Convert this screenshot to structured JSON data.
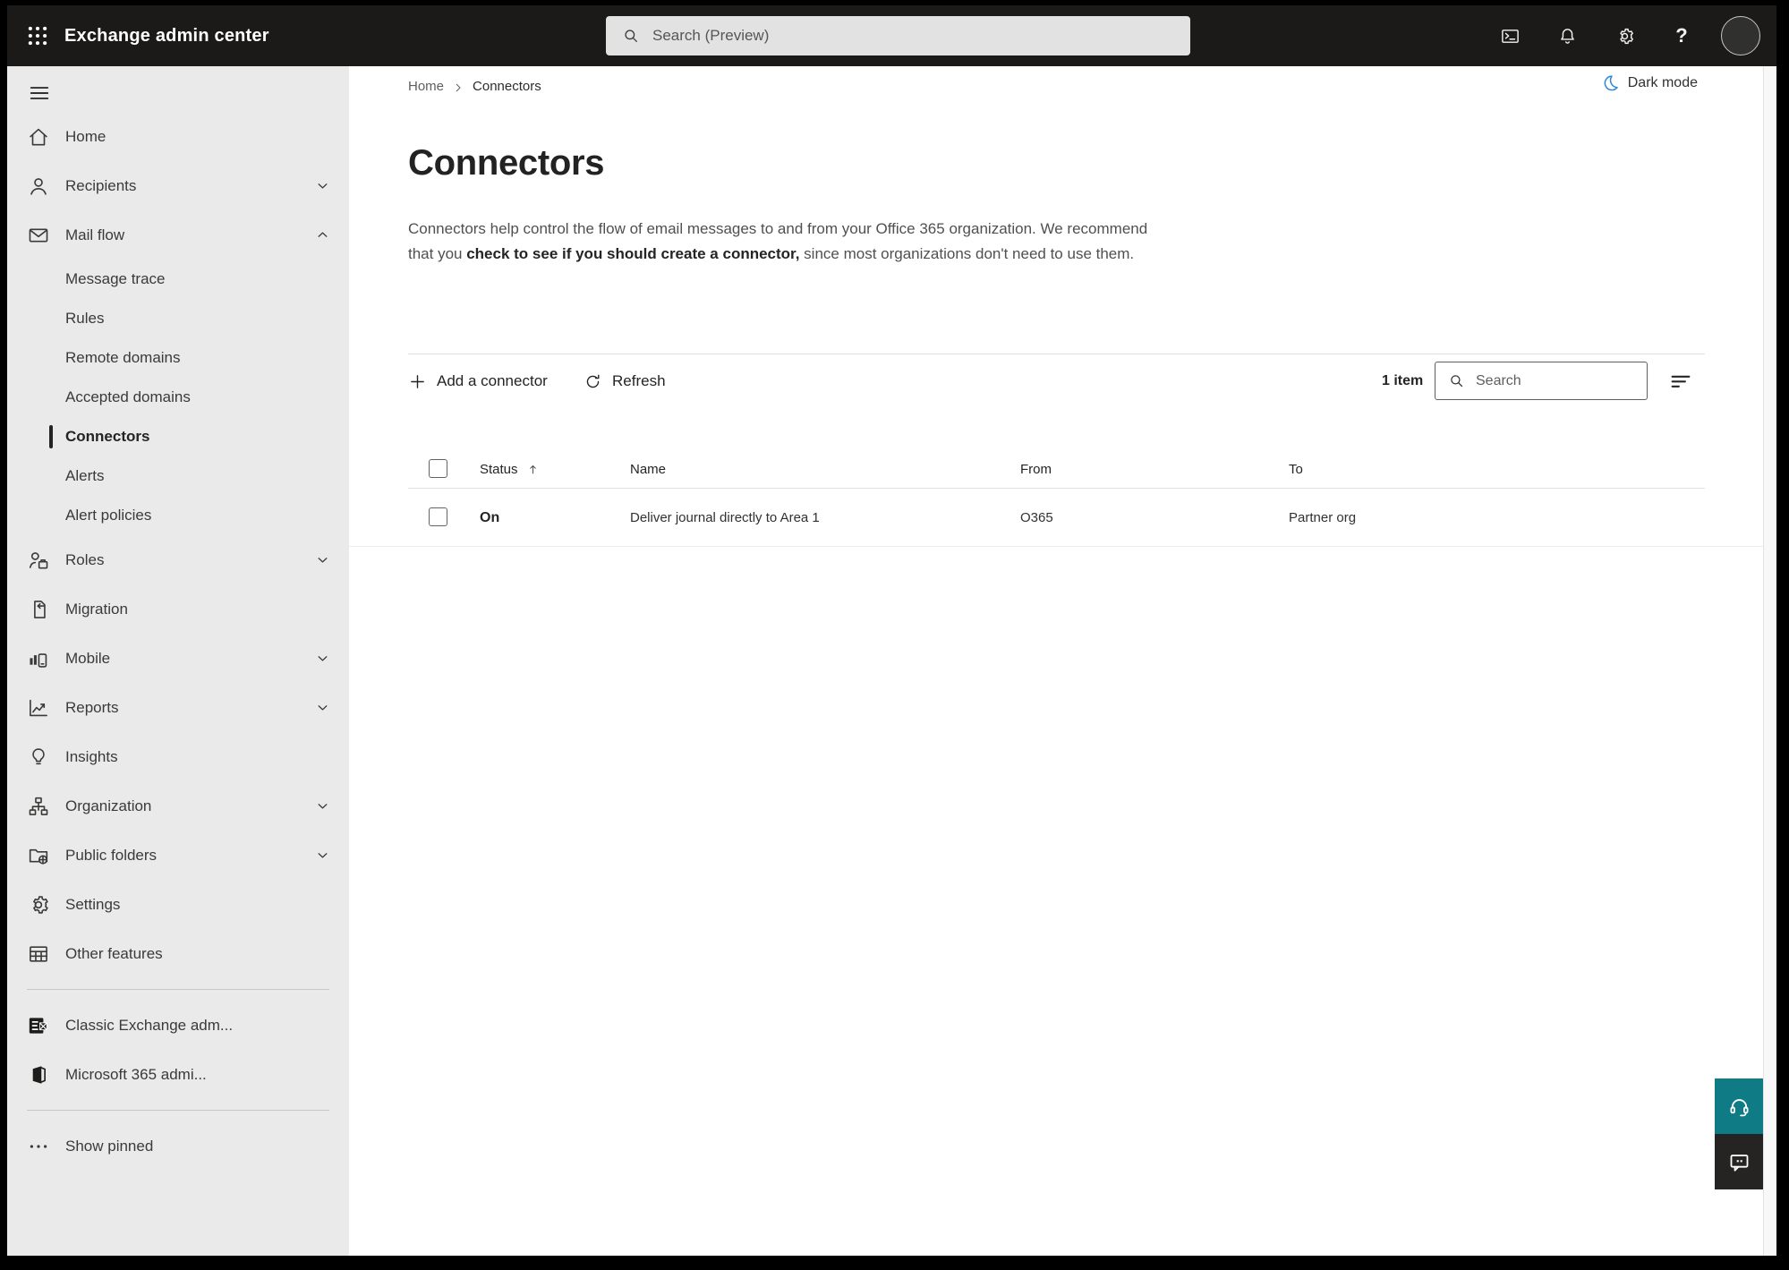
{
  "colors": {
    "topbar_bg": "#1b1a19",
    "sidebar_bg": "#eaeaea",
    "dark_mode_icon_blue": "#2b88d8",
    "support_button_teal": "#0f7b84",
    "feedback_button_dark": "#252422"
  },
  "topbar": {
    "title": "Exchange admin center",
    "search_placeholder": "Search (Preview)",
    "help_glyph": "?"
  },
  "sidebar": {
    "items": [
      {
        "label": "Home",
        "icon": "home-icon"
      },
      {
        "label": "Recipients",
        "icon": "person-icon",
        "chevron": "down"
      },
      {
        "label": "Mail flow",
        "icon": "mail-icon",
        "chevron": "up"
      },
      {
        "label": "Message trace",
        "sub": true
      },
      {
        "label": "Rules",
        "sub": true
      },
      {
        "label": "Remote domains",
        "sub": true
      },
      {
        "label": "Accepted domains",
        "sub": true
      },
      {
        "label": "Connectors",
        "sub": true,
        "selected": true
      },
      {
        "label": "Alerts",
        "sub": true
      },
      {
        "label": "Alert policies",
        "sub": true
      },
      {
        "label": "Roles",
        "icon": "roles-icon",
        "chevron": "down"
      },
      {
        "label": "Migration",
        "icon": "migration-icon"
      },
      {
        "label": "Mobile",
        "icon": "mobile-icon",
        "chevron": "down"
      },
      {
        "label": "Reports",
        "icon": "reports-icon",
        "chevron": "down"
      },
      {
        "label": "Insights",
        "icon": "insights-icon"
      },
      {
        "label": "Organization",
        "icon": "organization-icon",
        "chevron": "down"
      },
      {
        "label": "Public folders",
        "icon": "public-folders-icon",
        "chevron": "down"
      },
      {
        "label": "Settings",
        "icon": "settings-icon"
      },
      {
        "label": "Other features",
        "icon": "other-features-icon"
      },
      {
        "divider": true
      },
      {
        "label": "Classic Exchange adm...",
        "icon": "classic-exchange-icon"
      },
      {
        "label": "Microsoft 365 admi...",
        "icon": "m365-icon"
      },
      {
        "divider": true
      },
      {
        "label": "Show pinned",
        "icon": "ellipsis-icon"
      }
    ]
  },
  "main": {
    "breadcrumb": {
      "home": "Home",
      "current": "Connectors"
    },
    "dark_mode_label": "Dark mode",
    "title": "Connectors",
    "description": {
      "part1": "Connectors help control the flow of email messages to and from your Office 365 organization. We recommend that you ",
      "link": "check to see if you should create a connector,",
      "part3": " since most organizations don't need to use them."
    },
    "toolbar": {
      "add_label": "Add a connector",
      "refresh_label": "Refresh",
      "item_count": "1 item",
      "search_placeholder": "Search"
    },
    "table": {
      "columns": [
        {
          "label": "Status",
          "sorted": "asc"
        },
        {
          "label": "Name"
        },
        {
          "label": "From"
        },
        {
          "label": "To"
        }
      ],
      "rows": [
        {
          "status": "On",
          "name": "Deliver journal directly to Area 1",
          "from": "O365",
          "to": "Partner org"
        }
      ]
    }
  }
}
